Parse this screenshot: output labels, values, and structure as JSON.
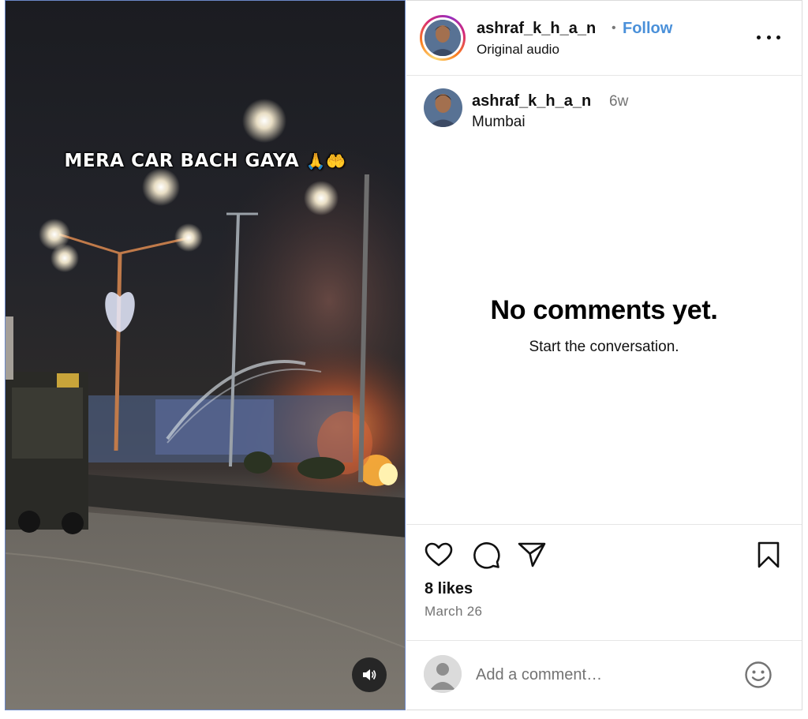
{
  "video": {
    "overlay_text": "MERA CAR BACH GAYA",
    "overlay_emoji": "🙏🤲",
    "mute_icon": "speaker-icon"
  },
  "header": {
    "username": "ashraf_k_h_a_n",
    "separator": "•",
    "follow_label": "Follow",
    "audio_label": "Original audio",
    "more_icon": "more-dots-icon"
  },
  "caption": {
    "username": "ashraf_k_h_a_n",
    "age": "6w",
    "location": "Mumbai"
  },
  "comments": {
    "empty_title": "No comments yet.",
    "empty_subtitle": "Start the conversation."
  },
  "actions": {
    "icons": [
      "heart-icon",
      "comment-icon",
      "share-icon",
      "bookmark-icon"
    ],
    "likes": "8 likes",
    "date": "March 26"
  },
  "comment_box": {
    "placeholder": "Add a comment…",
    "emoji_icon": "smiley-icon"
  },
  "colors": {
    "follow": "#4a90d9",
    "muted_text": "#737373",
    "divider": "#e6e6e6"
  }
}
